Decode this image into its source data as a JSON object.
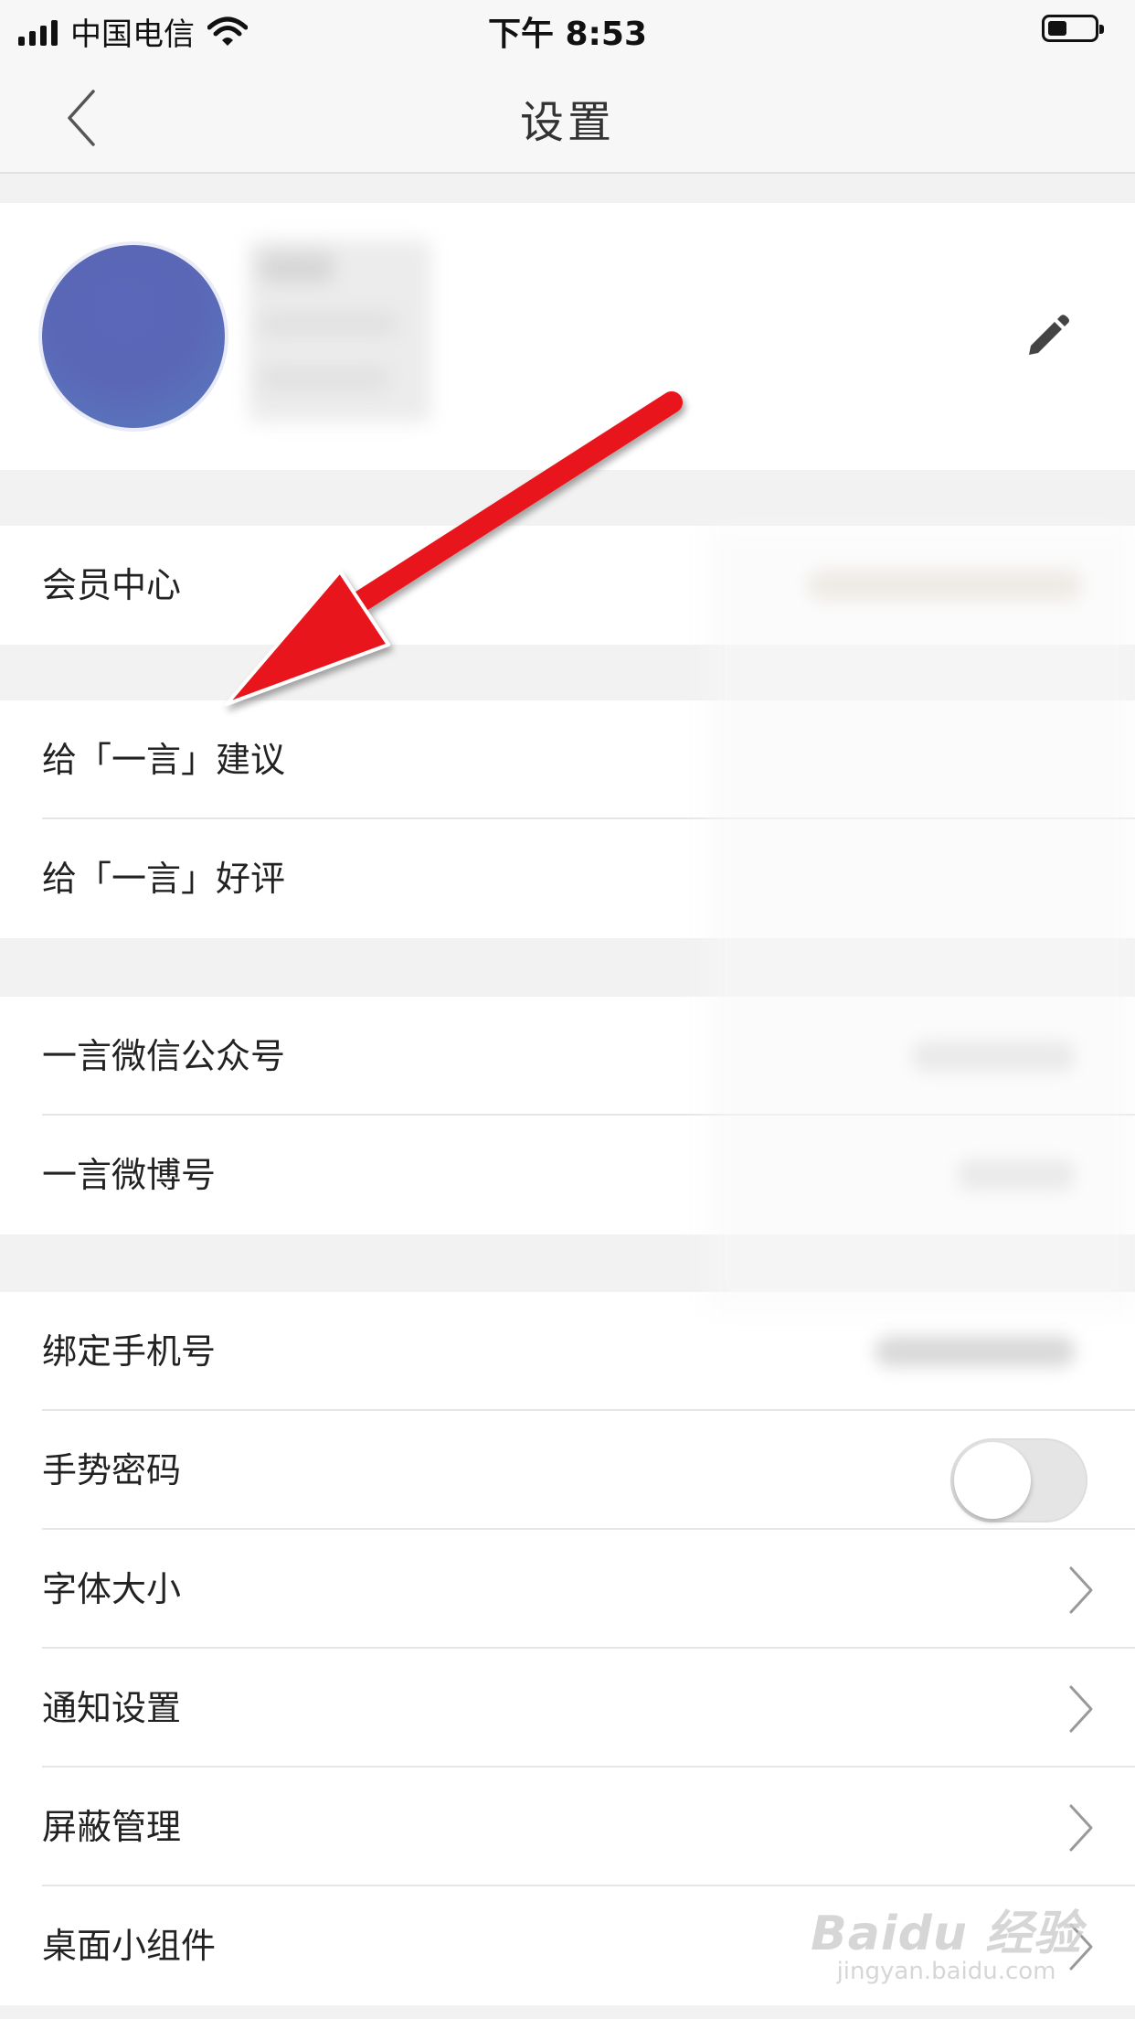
{
  "status_bar": {
    "carrier": "中国电信",
    "time": "下午 8:53"
  },
  "nav": {
    "title": "设置"
  },
  "sections": {
    "membership": [
      {
        "label": "会员中心"
      }
    ],
    "feedback": [
      {
        "label": "给「一言」建议"
      },
      {
        "label": "给「一言」好评"
      }
    ],
    "social": [
      {
        "label": "一言微信公众号"
      },
      {
        "label": "一言微博号"
      }
    ],
    "settings": [
      {
        "label": "绑定手机号"
      },
      {
        "label": "手势密码",
        "toggle_on": false
      },
      {
        "label": "字体大小"
      },
      {
        "label": "通知设置"
      },
      {
        "label": "屏蔽管理"
      },
      {
        "label": "桌面小组件"
      }
    ]
  },
  "watermark": {
    "brand": "Baidu 经验",
    "url": "jingyan.baidu.com"
  },
  "colors": {
    "annotation_arrow": "#e8141b",
    "avatar": "#5a66b6",
    "background": "#f2f2f2"
  },
  "icons": [
    "back-chevron-icon",
    "wifi-icon",
    "battery-icon",
    "edit-pencil-icon",
    "chevron-right-icon"
  ]
}
